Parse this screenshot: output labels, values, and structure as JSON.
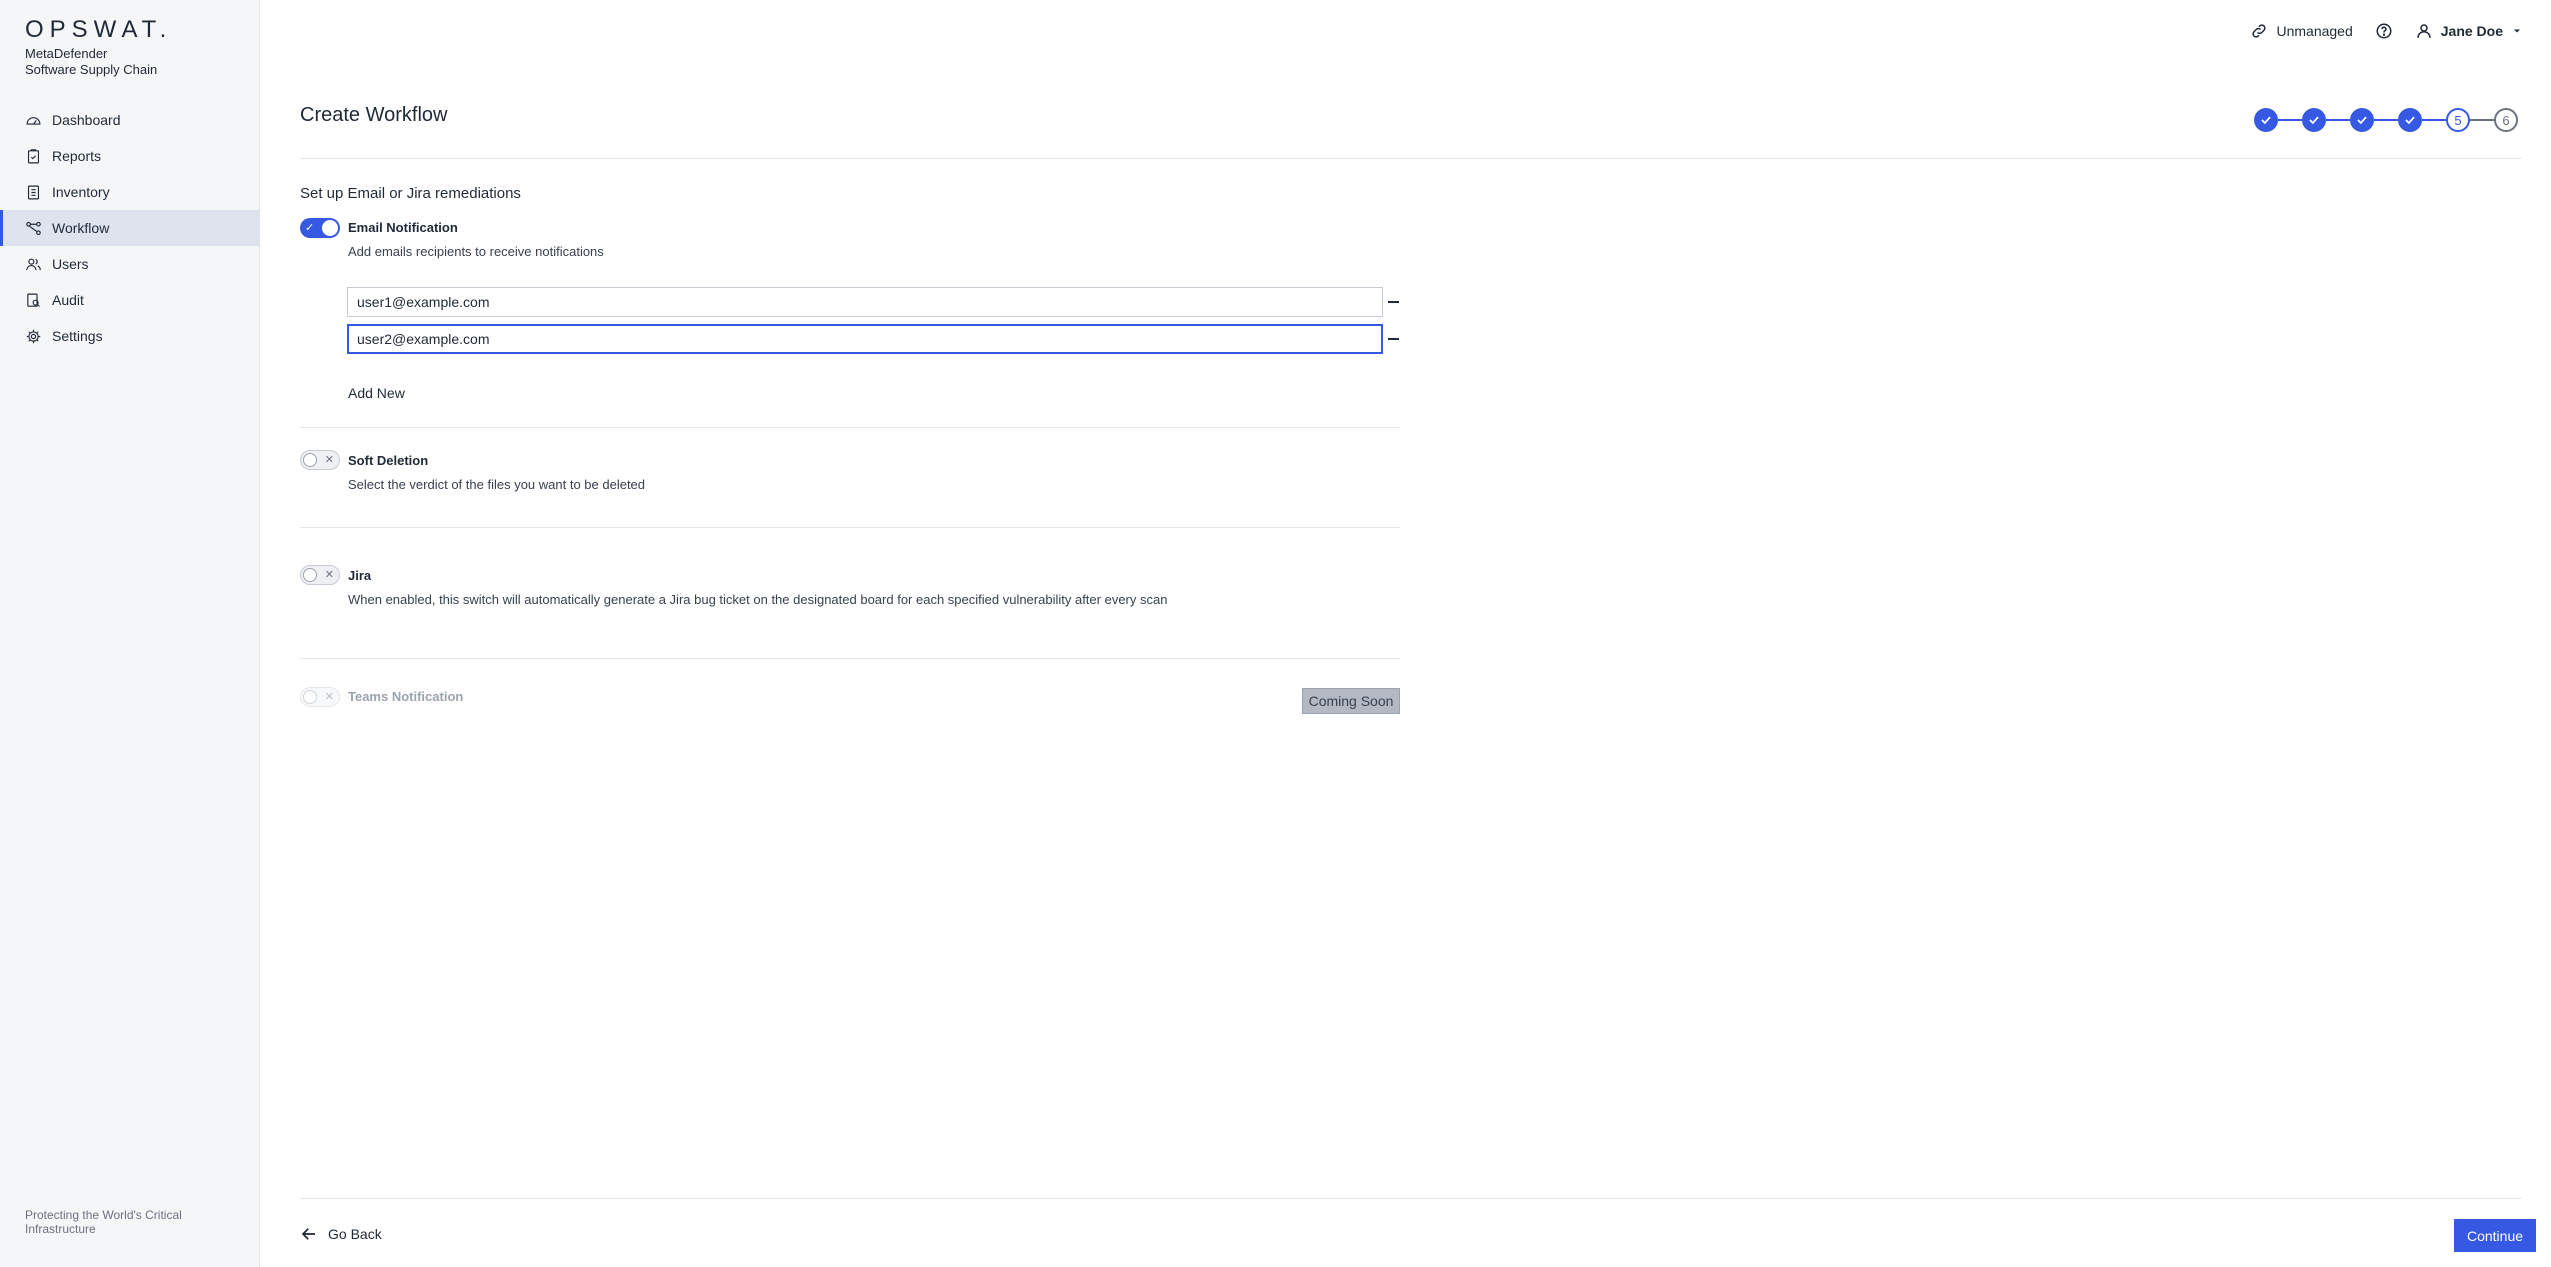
{
  "brand": {
    "logo": "OPSWAT.",
    "product_line1": "MetaDefender",
    "product_line2": "Software Supply Chain"
  },
  "sidebar": {
    "items": [
      {
        "label": "Dashboard",
        "icon": "dashboard-icon"
      },
      {
        "label": "Reports",
        "icon": "reports-icon"
      },
      {
        "label": "Inventory",
        "icon": "inventory-icon"
      },
      {
        "label": "Workflow",
        "icon": "workflow-icon",
        "active": true
      },
      {
        "label": "Users",
        "icon": "users-icon"
      },
      {
        "label": "Audit",
        "icon": "audit-icon"
      },
      {
        "label": "Settings",
        "icon": "gear-icon"
      }
    ],
    "footer": "Protecting the World's Critical Infrastructure"
  },
  "topbar": {
    "unmanaged": "Unmanaged",
    "user": "Jane Doe"
  },
  "main": {
    "title": "Create Workflow",
    "stepper": {
      "step5": "5",
      "step6": "6",
      "current_step": 5,
      "total_steps": 6
    },
    "setup_label": "Set up Email or Jira remediations",
    "email": {
      "title": "Email Notification",
      "desc": "Add emails recipients to receive notifications",
      "enabled": true,
      "recipients": [
        "user1@example.com",
        "user2@example.com"
      ],
      "add_new": "Add New"
    },
    "soft_deletion": {
      "title": "Soft Deletion",
      "desc": "Select the verdict of the files you want to be deleted",
      "enabled": false
    },
    "jira": {
      "title": "Jira",
      "desc": "When enabled, this switch will automatically generate a Jira bug ticket on the designated board for each specified vulnerability after every scan",
      "enabled": false
    },
    "teams": {
      "title": "Teams Notification",
      "badge": "Coming Soon",
      "enabled": false
    }
  },
  "footer": {
    "go_back": "Go Back",
    "continue": "Continue"
  },
  "colors": {
    "accent": "#3659e3",
    "sidebar_bg": "#f5f6f8",
    "active_bg": "#dfe3ee"
  }
}
